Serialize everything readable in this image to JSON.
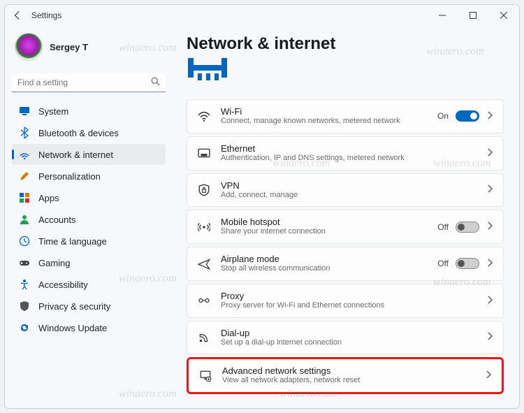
{
  "titlebar": {
    "app": "Settings"
  },
  "profile": {
    "name": "Sergey T",
    "email": " "
  },
  "search": {
    "placeholder": "Find a setting"
  },
  "sidebar": {
    "items": [
      {
        "label": "System"
      },
      {
        "label": "Bluetooth & devices"
      },
      {
        "label": "Network & internet"
      },
      {
        "label": "Personalization"
      },
      {
        "label": "Apps"
      },
      {
        "label": "Accounts"
      },
      {
        "label": "Time & language"
      },
      {
        "label": "Gaming"
      },
      {
        "label": "Accessibility"
      },
      {
        "label": "Privacy & security"
      },
      {
        "label": "Windows Update"
      }
    ],
    "active_index": 2
  },
  "page": {
    "title": "Network & internet",
    "cards": [
      {
        "title": "Wi-Fi",
        "sub": "Connect, manage known networks, metered network",
        "state": "On",
        "toggle": true
      },
      {
        "title": "Ethernet",
        "sub": "Authentication, IP and DNS settings, metered network"
      },
      {
        "title": "VPN",
        "sub": "Add, connect, manage"
      },
      {
        "title": "Mobile hotspot",
        "sub": "Share your internet connection",
        "state": "Off",
        "toggle": false
      },
      {
        "title": "Airplane mode",
        "sub": "Stop all wireless communication",
        "state": "Off",
        "toggle": false
      },
      {
        "title": "Proxy",
        "sub": "Proxy server for Wi-Fi and Ethernet connections"
      },
      {
        "title": "Dial-up",
        "sub": "Set up a dial-up internet connection"
      },
      {
        "title": "Advanced network settings",
        "sub": "View all network adapters, network reset",
        "highlight": true
      }
    ]
  },
  "watermark": "winaero.com"
}
